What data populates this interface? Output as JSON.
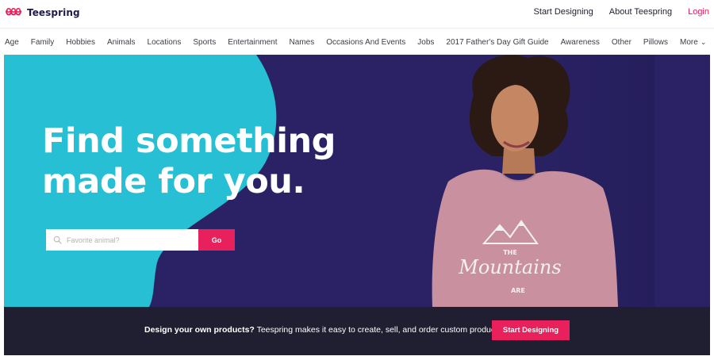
{
  "header": {
    "logo_text": "Teespring",
    "links": [
      {
        "label": "Start Designing"
      },
      {
        "label": "About Teespring"
      },
      {
        "label": "Login"
      }
    ]
  },
  "categories": [
    "Age",
    "Family",
    "Hobbies",
    "Animals",
    "Locations",
    "Sports",
    "Entertainment",
    "Names",
    "Occasions And Events",
    "Jobs",
    "2017 Father's Day Gift Guide",
    "Awareness",
    "Other",
    "Pillows",
    "More"
  ],
  "hero": {
    "headline_line1": "Find something",
    "headline_line2": "made for you.",
    "search_placeholder": "Favorite animal?",
    "go_label": "Go",
    "shirt_text_line1": "THE",
    "shirt_text_line2": "Mountains",
    "shirt_text_line3": "ARE"
  },
  "banner": {
    "bold_text": "Design your own products?",
    "text": " Teespring makes it easy to create, sell, and order custom products.",
    "button_label": "Start Designing"
  },
  "colors": {
    "brand_pink": "#e8205b",
    "hero_navy": "#2a2265",
    "hero_teal": "#26bfd3",
    "banner_dark": "#201e31"
  }
}
